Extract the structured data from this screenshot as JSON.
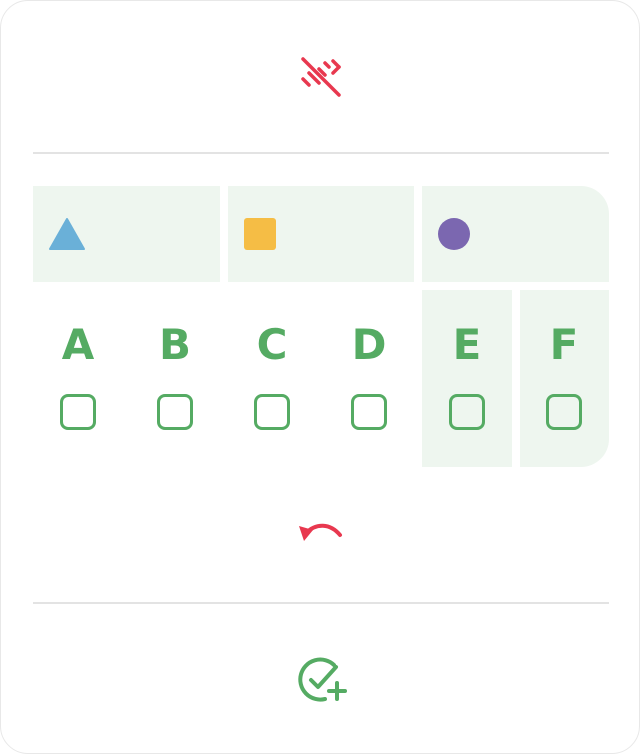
{
  "toolbar": {
    "clear_icon": "erase-marks-icon",
    "undo_icon": "undo-icon",
    "confirm_icon": "check-add-icon",
    "danger_color": "#e8384f",
    "success_color": "#55ab63"
  },
  "shapes": [
    {
      "name": "triangle",
      "color": "#6ab0d8"
    },
    {
      "name": "square",
      "color": "#f5bd45"
    },
    {
      "name": "circle",
      "color": "#7b67b0"
    }
  ],
  "columns": [
    {
      "label": "A",
      "checked": false
    },
    {
      "label": "B",
      "checked": false
    },
    {
      "label": "C",
      "checked": false
    },
    {
      "label": "D",
      "checked": false
    },
    {
      "label": "E",
      "checked": false
    },
    {
      "label": "F",
      "checked": false
    }
  ],
  "panel_color": "#eef6ef"
}
